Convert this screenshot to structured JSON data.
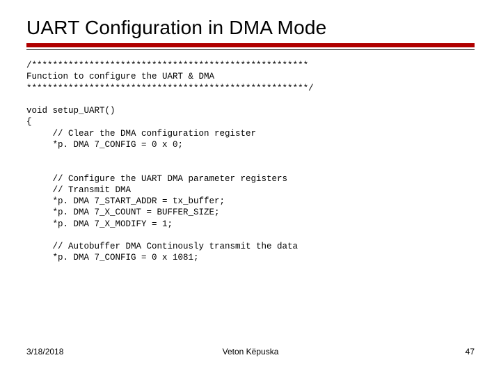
{
  "title": "UART Configuration in DMA Mode",
  "code_comment_open": "/*****************************************************",
  "code_comment_desc": "Function to configure the UART & DMA",
  "code_comment_close": "******************************************************/",
  "code_fn_sig": "void setup_UART()",
  "code_brace": "{",
  "code_c1": "     // Clear the DMA configuration register",
  "code_l1": "     *p. DMA 7_CONFIG = 0 x 0;",
  "code_c2": "     // Configure the UART DMA parameter registers",
  "code_c3": "     // Transmit DMA",
  "code_l2": "     *p. DMA 7_START_ADDR = tx_buffer;",
  "code_l3": "     *p. DMA 7_X_COUNT = BUFFER_SIZE;",
  "code_l4": "     *p. DMA 7_X_MODIFY = 1;",
  "code_c4": "     // Autobuffer DMA Continously transmit the data",
  "code_l5": "     *p. DMA 7_CONFIG = 0 x 1081;",
  "footer": {
    "date": "3/18/2018",
    "author": "Veton Këpuska",
    "page": "47"
  }
}
